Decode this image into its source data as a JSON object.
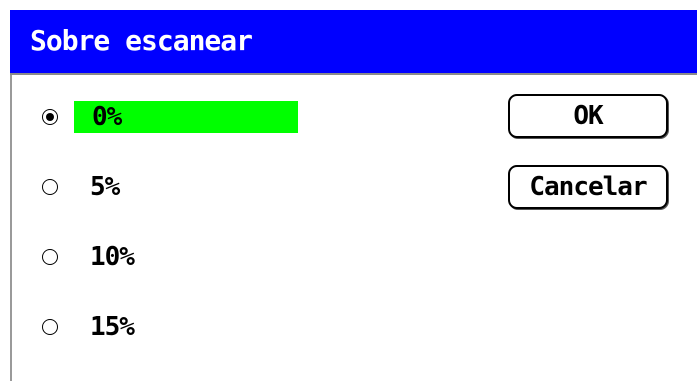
{
  "dialog": {
    "title": "Sobre escanear",
    "options": [
      {
        "label": "0%",
        "selected": true
      },
      {
        "label": "5%",
        "selected": false
      },
      {
        "label": "10%",
        "selected": false
      },
      {
        "label": "15%",
        "selected": false
      }
    ],
    "buttons": {
      "ok_label": "OK",
      "cancel_label": "Cancelar"
    }
  },
  "colors": {
    "titlebar": "#0000ff",
    "title_text": "#ffffff",
    "highlight": "#00ff00"
  }
}
